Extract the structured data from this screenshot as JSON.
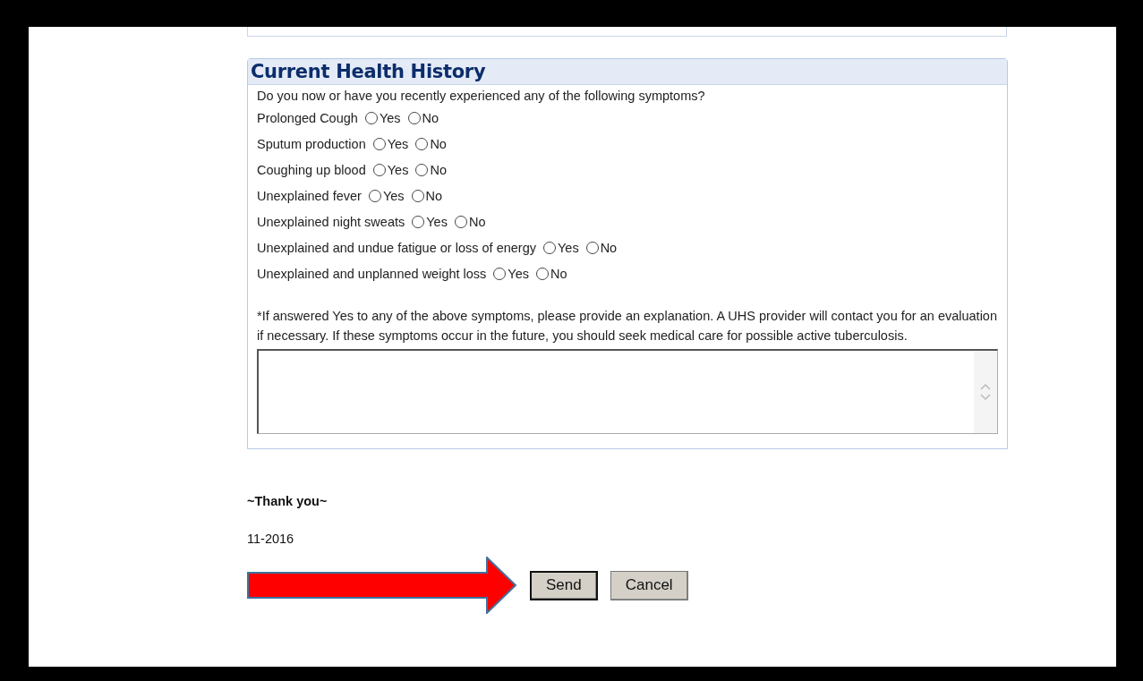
{
  "section": {
    "title": "Current Health History",
    "prompt": "Do you now or have you recently experienced any of the following symptoms?",
    "questions": [
      {
        "label": "Prolonged Cough",
        "options": [
          {
            "label": "Yes",
            "selected": false
          },
          {
            "label": "No",
            "selected": false
          }
        ]
      },
      {
        "label": "Sputum production",
        "options": [
          {
            "label": "Yes",
            "selected": false
          },
          {
            "label": "No",
            "selected": false
          }
        ]
      },
      {
        "label": "Coughing up blood",
        "options": [
          {
            "label": "Yes",
            "selected": false
          },
          {
            "label": "No",
            "selected": false
          }
        ]
      },
      {
        "label": "Unexplained fever",
        "options": [
          {
            "label": "Yes",
            "selected": false
          },
          {
            "label": "No",
            "selected": false
          }
        ]
      },
      {
        "label": "Unexplained night sweats",
        "options": [
          {
            "label": "Yes",
            "selected": false
          },
          {
            "label": "No",
            "selected": false
          }
        ]
      },
      {
        "label": "Unexplained and undue fatigue or loss of energy",
        "options": [
          {
            "label": "Yes",
            "selected": false
          },
          {
            "label": "No",
            "selected": false
          }
        ]
      },
      {
        "label": "Unexplained and unplanned weight loss",
        "options": [
          {
            "label": "Yes",
            "selected": false
          },
          {
            "label": "No",
            "selected": false
          }
        ]
      }
    ],
    "note": "*If answered Yes to any of the above symptoms, please provide an explanation. A UHS provider will contact you for an evaluation if necessary. If these symptoms occur in the future, you should seek medical care for possible active tuberculosis."
  },
  "thanks": "~Thank you~",
  "version": "11-2016",
  "buttons": [
    {
      "label": "Send",
      "kind": "default"
    },
    {
      "label": "Cancel",
      "kind": "normal"
    }
  ]
}
